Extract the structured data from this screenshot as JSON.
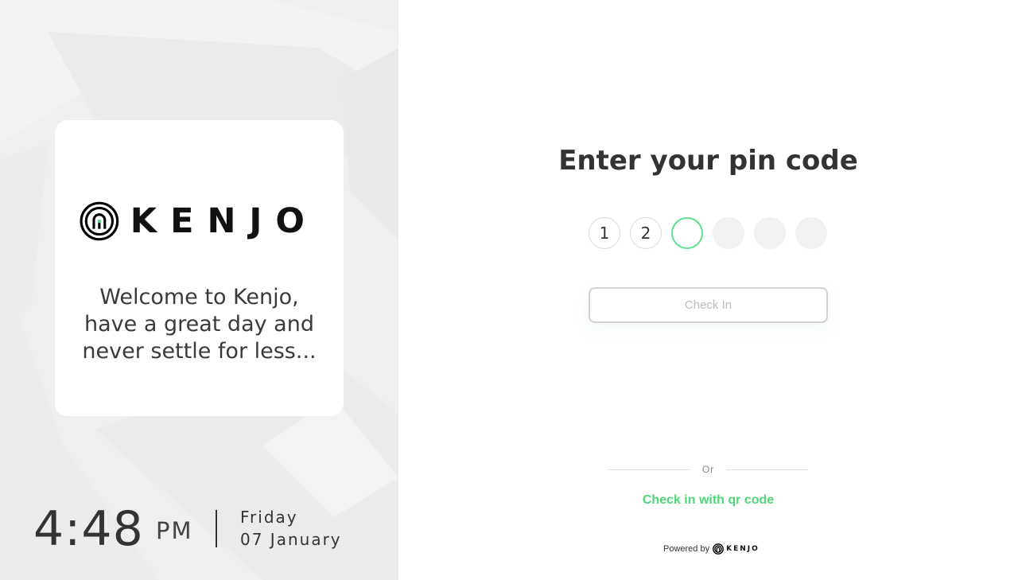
{
  "welcome": {
    "brand": "KENJO",
    "message": "Welcome to Kenjo, have a great day and never settle for less..."
  },
  "clock": {
    "time": "4:48",
    "ampm": "PM",
    "day": "Friday",
    "date": "07 January"
  },
  "pin": {
    "title": "Enter your pin code",
    "digits": [
      "1",
      "2",
      "",
      "",
      "",
      ""
    ],
    "active_index": 2
  },
  "actions": {
    "check_in_label": "Check In",
    "or_label": "Or",
    "qr_link_label": "Check in with qr code"
  },
  "footer": {
    "powered_by": "Powered by",
    "brand": "KENJO"
  },
  "colors": {
    "accent_green": "#4fd67b",
    "left_panel_bg": "#efefef"
  },
  "icons": {
    "logo": "kenjo-logo-icon"
  }
}
